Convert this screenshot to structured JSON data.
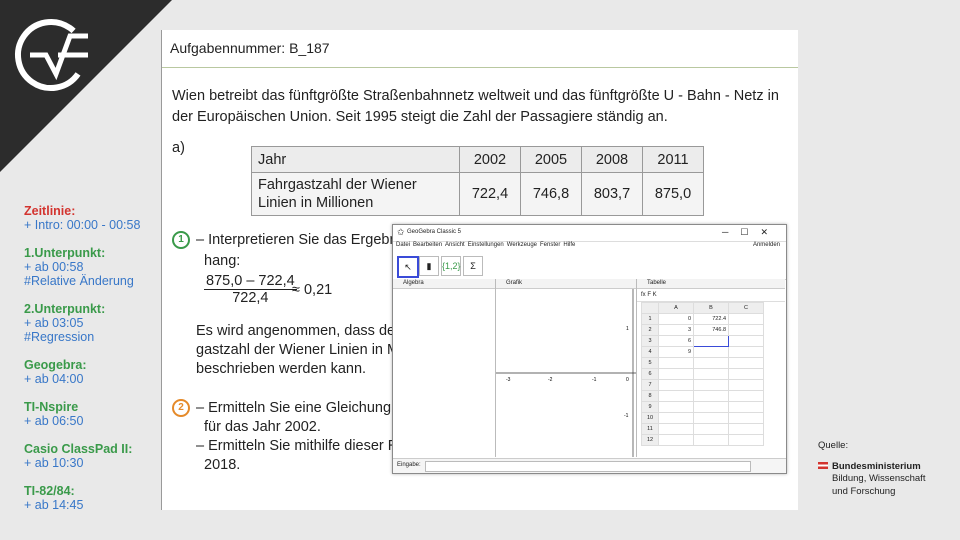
{
  "sidebar": [
    {
      "title": "Zeitlinie:",
      "lines": [
        "+ Intro: 00:00 - 00:58"
      ],
      "red": true
    },
    {
      "title": "1.Unterpunkt:",
      "lines": [
        "+ ab 00:58",
        "#Relative Änderung"
      ]
    },
    {
      "title": "2.Unterpunkt:",
      "lines": [
        "+ ab 03:05",
        "#Regression"
      ]
    },
    {
      "title": "Geogebra:",
      "lines": [
        "+ ab 04:00"
      ]
    },
    {
      "title": "TI-Nspire",
      "lines": [
        "+ ab 06:50"
      ]
    },
    {
      "title": "Casio ClassPad II:",
      "lines": [
        "+ ab 10:30"
      ]
    },
    {
      "title": "TI-82/84:",
      "lines": [
        "+ ab 14:45"
      ]
    }
  ],
  "task": {
    "header": "Aufgabennummer: B_187",
    "intro": "Wien betreibt das fünftgrößte Straßenbahnnetz weltweit und das fünftgrößte U - Bahn - Netz in der Europäischen Union. Seit 1995 steigt die Zahl der Passagiere ständig an.",
    "part": "a)",
    "table": {
      "col0": "Jahr",
      "years": [
        "2002",
        "2005",
        "2008",
        "2011"
      ],
      "row_label": "Fahrgastzahl der Wiener Linien in Millionen",
      "values": [
        "722,4",
        "746,8",
        "803,7",
        "875,0"
      ]
    },
    "item1_num": "1",
    "item1_line1": "– Interpretieren Sie das Ergebnis",
    "item1_line2": "hang:",
    "frac_num": "875,0 – 722,4",
    "frac_den": "722,4",
    "frac_result": "≈ 0,21",
    "para_line1": "Es wird angenommen, dass der",
    "para_line2": "gastzahl der Wiener Linien in Mi",
    "para_line3": "beschrieben werden kann.",
    "item2_num": "2",
    "item2_line1": "– Ermitteln Sie eine Gleichung d",
    "item2_line2": "für das Jahr 2002.",
    "item2_line3": "– Ermitteln Sie mithilfe dieser Re",
    "item2_line4": "2018."
  },
  "geogebra": {
    "title": "GeoGebra Classic 5",
    "menu": [
      "Datei",
      "Bearbeiten",
      "Ansicht",
      "Einstellungen",
      "Werkzeuge",
      "Fenster",
      "Hilfe"
    ],
    "login": "Anmelden",
    "tool_list": "{1,2}",
    "tool_sum": "Σ",
    "views": {
      "algebra": "Algebra",
      "graph": "Grafik",
      "sheet": "Tabelle"
    },
    "graph_ticks_x": [
      "-3",
      "-2",
      "-1",
      "0"
    ],
    "graph_ticks_y": [
      "1",
      "-1"
    ],
    "sheet_toolbar": "fx  F  K",
    "sheet_cols": [
      "A",
      "B",
      "C"
    ],
    "sheet_rows": [
      [
        "1",
        "0",
        "722.4",
        ""
      ],
      [
        "2",
        "3",
        "746.8",
        ""
      ],
      [
        "3",
        "6",
        "",
        ""
      ],
      [
        "4",
        "9",
        "",
        ""
      ],
      [
        "5",
        "",
        "",
        ""
      ],
      [
        "6",
        "",
        "",
        ""
      ],
      [
        "7",
        "",
        "",
        ""
      ],
      [
        "8",
        "",
        "",
        ""
      ],
      [
        "9",
        "",
        "",
        ""
      ],
      [
        "10",
        "",
        "",
        ""
      ],
      [
        "11",
        "",
        "",
        ""
      ],
      [
        "12",
        "",
        "",
        ""
      ]
    ],
    "input_label": "Eingabe:"
  },
  "source": {
    "label": "Quelle:",
    "line1": "Bundesministerium",
    "line2": "Bildung, Wissenschaft",
    "line3": "und Forschung"
  }
}
